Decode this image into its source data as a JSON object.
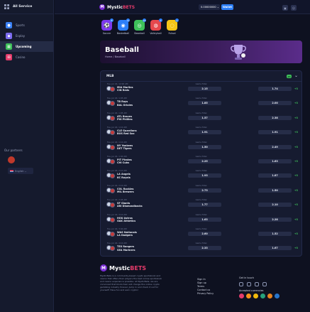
{
  "sidebar": {
    "header": "All Service",
    "items": [
      {
        "label": "Sports",
        "icon": "sports-icon",
        "color": "#3b82f6"
      },
      {
        "label": "Esplay",
        "icon": "esports-icon",
        "color": "#7c6cf0"
      },
      {
        "label": "Upcoming",
        "icon": "calendar-icon",
        "color": "#3ec15a"
      },
      {
        "label": "Casino",
        "icon": "dice-icon",
        "color": "#e53b6b"
      }
    ],
    "partners_label": "Our partners",
    "language": "English"
  },
  "topbar": {
    "logo_mystic": "Mystic",
    "logo_bets": "BETS",
    "balance": "0.00000000",
    "deposit": "Wallet"
  },
  "categories": [
    {
      "label": "Soccer",
      "color": "#7c3aed",
      "glyph": "⚽",
      "badge": "8"
    },
    {
      "label": "Basketball",
      "color": "#2d7ff9",
      "glyph": "◉",
      "badge": "12"
    },
    {
      "label": "Baseball",
      "color": "#3ec15a",
      "glyph": "◎",
      "badge": "16"
    },
    {
      "label": "Volleyball",
      "color": "#e5484d",
      "glyph": "◍",
      "badge": "3"
    },
    {
      "label": "Futsal",
      "color": "#f5c518",
      "glyph": "◌",
      "badge": "4"
    }
  ],
  "banner": {
    "title": "Baseball",
    "breadcrumb": "Home / Baseball"
  },
  "league": {
    "name": "MLB",
    "count": "13"
  },
  "market_label": "Game Total",
  "matches": [
    {
      "date": "Tue, Jul 22, 12:00 AM",
      "team1": "MIA Marlins",
      "team2": "CIN Reds",
      "odd1": "2.15",
      "odd2": "1.74",
      "more": "+3"
    },
    {
      "date": "Tue, Jul 22, 1:05 AM",
      "team1": "TB Rays",
      "team2": "BAL Orioles",
      "odd1": "1.85",
      "odd2": "2.00",
      "more": "+3"
    },
    {
      "date": "Tue, Jul 22, 1:05 AM",
      "team1": "ATL Braves",
      "team2": "PHI Phillies",
      "odd1": "1.57",
      "odd2": "2.38",
      "more": "+3"
    },
    {
      "date": "Tue, Jul 22, 1:10 AM",
      "team1": "CLE Guardians",
      "team2": "BOS Red Sox",
      "odd1": "1.91",
      "odd2": "1.91",
      "more": "+3"
    },
    {
      "date": "Tue, Jul 22, 1:10 AM",
      "team1": "NY Yankees",
      "team2": "DET Tigers",
      "odd1": "1.50",
      "odd2": "2.49",
      "more": "+3"
    },
    {
      "date": "Tue, Jul 22, 1:40 AM",
      "team1": "PIT Pirates",
      "team2": "CHI Cubs",
      "odd1": "2.25",
      "odd2": "1.63",
      "more": "+3"
    },
    {
      "date": "Tue, Jul 22, 2:10 AM",
      "team1": "LA Angels",
      "team2": "KC Royals",
      "odd1": "1.93",
      "odd2": "1.87",
      "more": "+3"
    },
    {
      "date": "Tue, Jul 22, 2:10 AM",
      "team1": "COL Rockies",
      "team2": "MIL Brewers",
      "odd1": "2.73",
      "odd2": "1.50",
      "more": "+3"
    },
    {
      "date": "Tue, Jul 22, 2:45 AM",
      "team1": "SF Giants",
      "team2": "ARI Diamondbacks",
      "odd1": "1.77",
      "odd2": "2.10",
      "more": "+3"
    },
    {
      "date": "Tue, Jul 22, 3:10 AM",
      "team1": "HOU Astros",
      "team2": "OAK Athletics",
      "odd1": "1.63",
      "odd2": "2.28",
      "more": "+3"
    },
    {
      "date": "Tue, Jul 22, 3:40 AM",
      "team1": "WAS Nationals",
      "team2": "LA Dodgers",
      "odd1": "2.60",
      "odd2": "1.52",
      "more": "+3"
    },
    {
      "date": "Tue, Jul 22, 4:10 AM",
      "team1": "TEX Rangers",
      "team2": "SEA Mariners",
      "odd1": "2.33",
      "odd2": "1.67",
      "more": "+3"
    }
  ],
  "footer": {
    "logo_mystic": "Mystic",
    "logo_bets": "BETS",
    "description": "MysticBets is a community-based crypto sportsbook and casino that offers their players the best online sportsbook and casino experience possible. At MysticBets, we are convinced that blockchain will change the online crypto gambling industry forever. Jump in and check it out for yourself! Have fun and earn crypto!",
    "links": [
      "Sign In",
      "Sign up",
      "Terms",
      "Contact us",
      "Privacy Policy"
    ],
    "touch_title": "Get in touch",
    "crypto_title": "Accepted currencies",
    "crypto_colors": [
      "#e53b6b",
      "#f7931a",
      "#f0b90b",
      "#26a17b",
      "#e8831d",
      "#2775ca"
    ]
  }
}
